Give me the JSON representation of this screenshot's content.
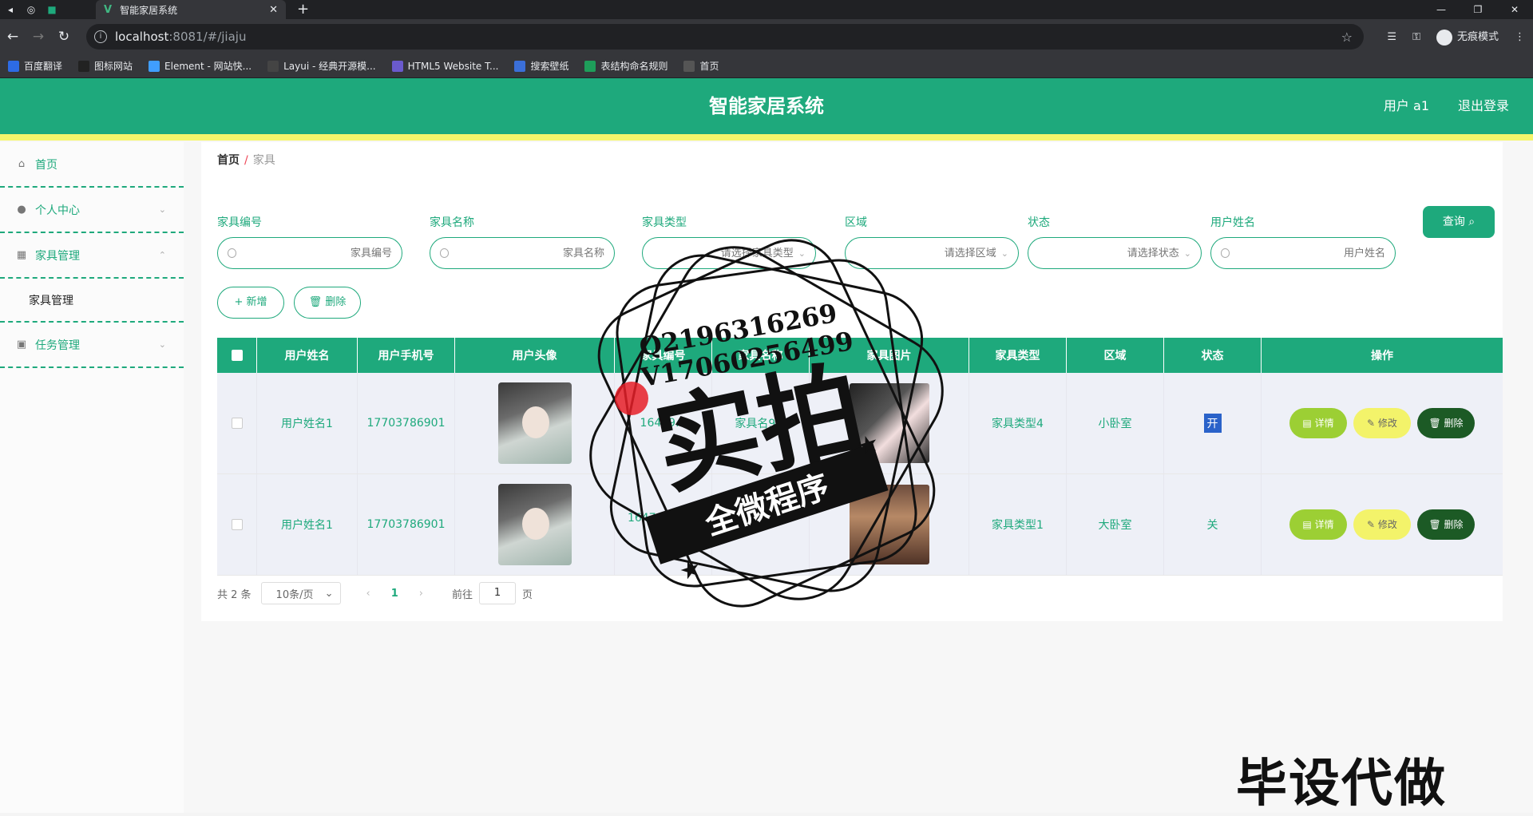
{
  "browser": {
    "tab_title": "智能家居系统",
    "url_host": "localhost",
    "url_path": ":8081/#/jiaju",
    "incognito_label": "无痕模式",
    "bookmarks": [
      {
        "label": "百度翻译",
        "color": "#2d6be4"
      },
      {
        "label": "图标网站",
        "color": "#222222"
      },
      {
        "label": "Element - 网站快...",
        "color": "#409eff"
      },
      {
        "label": "Layui - 经典开源模...",
        "color": "#444444"
      },
      {
        "label": "HTML5 Website T...",
        "color": "#6a5acd"
      },
      {
        "label": "搜索壁纸",
        "color": "#3b6fd8"
      },
      {
        "label": "表结构命名规则",
        "color": "#1e9e5a"
      },
      {
        "label": "首页",
        "color": "#555555"
      }
    ]
  },
  "header": {
    "title": "智能家居系统",
    "user": "用户 a1",
    "logout": "退出登录"
  },
  "sidebar": {
    "items": [
      {
        "label": "首页",
        "icon": "home-icon"
      },
      {
        "label": "个人中心",
        "icon": "user-icon"
      },
      {
        "label": "家具管理",
        "icon": "grid-icon"
      },
      {
        "label": "家具管理",
        "icon": ""
      },
      {
        "label": "任务管理",
        "icon": "task-icon"
      }
    ]
  },
  "breadcrumb": {
    "home": "首页",
    "current": "家具"
  },
  "filters": [
    {
      "label": "家具编号",
      "placeholder": "家具编号"
    },
    {
      "label": "家具名称",
      "placeholder": "家具名称"
    },
    {
      "label": "家具类型",
      "placeholder": "请选择家具类型"
    },
    {
      "label": "区域",
      "placeholder": "请选择区域"
    },
    {
      "label": "状态",
      "placeholder": "请选择状态"
    },
    {
      "label": "用户姓名",
      "placeholder": "用户姓名"
    }
  ],
  "actions": {
    "query": "查询",
    "add": "+ 新增",
    "delete": "删除"
  },
  "table": {
    "headers": [
      "用户姓名",
      "用户手机号",
      "用户头像",
      "家具编号",
      "家具名称",
      "家具图片",
      "家具类型",
      "区域",
      "状态",
      "操作"
    ],
    "rows": [
      {
        "name": "用户姓名1",
        "phone": "17703786901",
        "furn_no": "16479...",
        "furn_name": "家具名9...",
        "type": "家具类型4",
        "area": "小卧室",
        "state": "开"
      },
      {
        "name": "用户姓名1",
        "phone": "17703786901",
        "furn_no": "1647918423\n22",
        "furn_name": "",
        "type": "家具类型1",
        "area": "大卧室",
        "state": "关"
      }
    ],
    "op_detail": "详情",
    "op_edit": "修改",
    "op_delete": "删除"
  },
  "pager": {
    "total": "共 2 条",
    "size": "10条/页",
    "page": "1",
    "goto_label": "前往",
    "goto_value": "1",
    "page_suffix": "页"
  },
  "overlay": {
    "qq": "Q2196316269",
    "vx": "V17060256499",
    "big": "实拍",
    "banner": "全微程序",
    "corner": "毕设代做"
  }
}
